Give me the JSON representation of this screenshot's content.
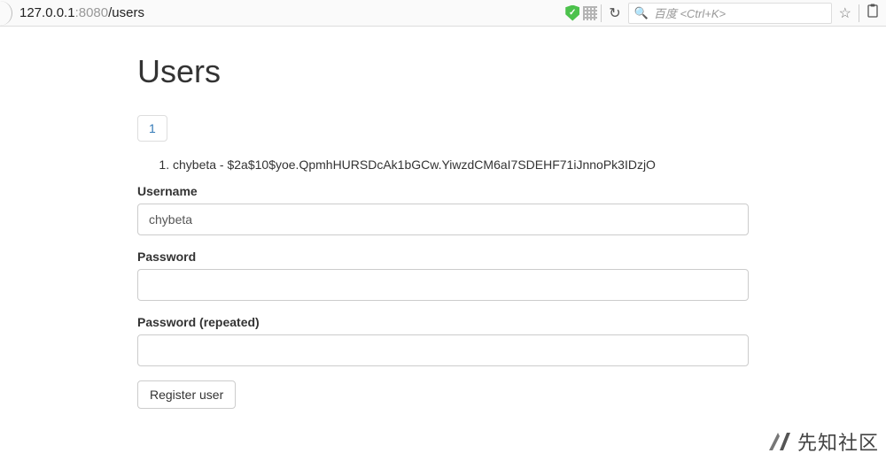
{
  "browser": {
    "url_host": "127.0.0.1",
    "url_port": ":8080",
    "url_path": "/users",
    "search_placeholder": "百度 <Ctrl+K>"
  },
  "page": {
    "title": "Users",
    "pagination": {
      "pages": [
        "1"
      ]
    },
    "users": [
      {
        "index": 1,
        "text": "chybeta - $2a$10$yoe.QpmhHURSDcAk1bGCw.YiwzdCM6aI7SDEHF71iJnnoPk3IDzjO"
      }
    ],
    "form": {
      "username_label": "Username",
      "username_value": "chybeta",
      "password_label": "Password",
      "password_value": "",
      "password2_label": "Password (repeated)",
      "password2_value": "",
      "submit_label": "Register user"
    }
  },
  "watermark": {
    "text": "先知社区"
  }
}
